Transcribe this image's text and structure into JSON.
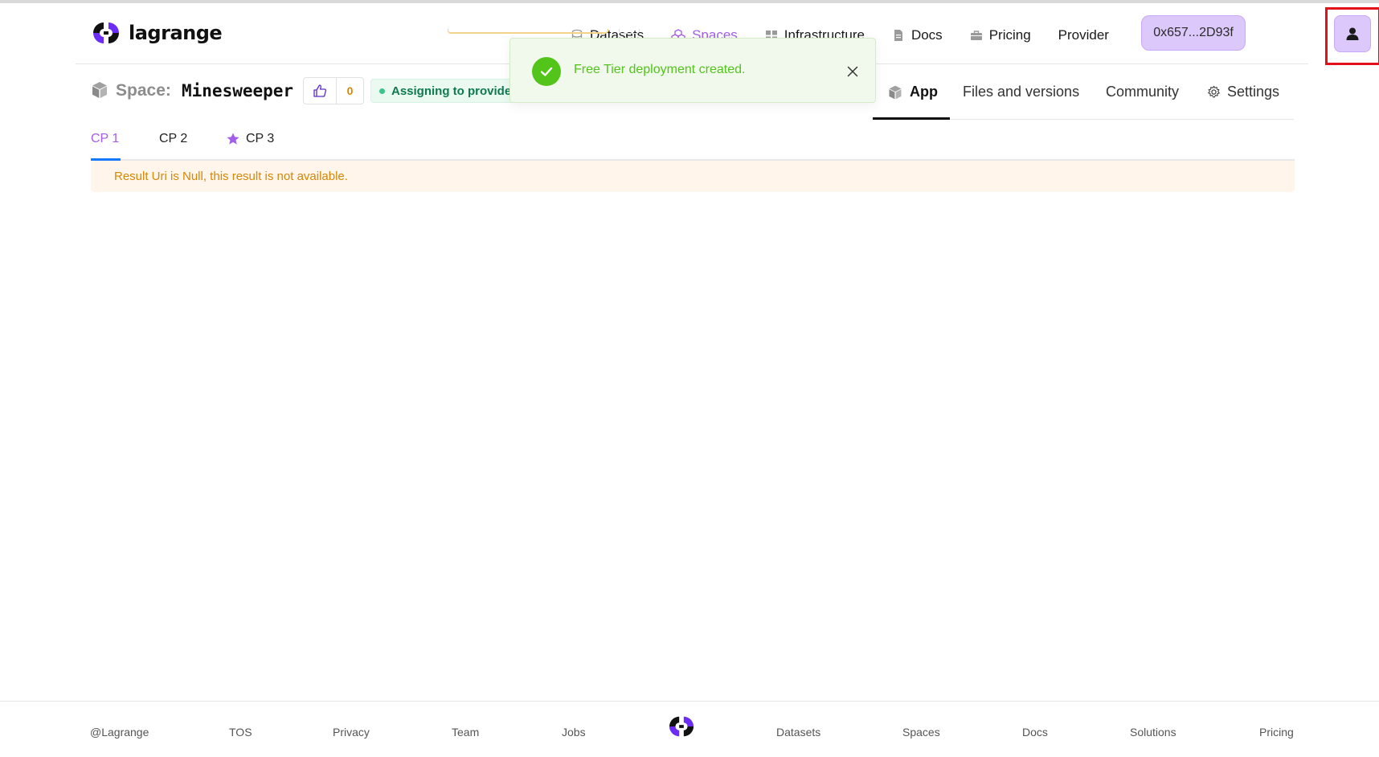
{
  "header": {
    "brand": "lagrange",
    "nav": [
      {
        "label": "Datasets",
        "icon": "database-icon"
      },
      {
        "label": "Spaces",
        "icon": "spaces-icon",
        "active": true
      },
      {
        "label": "Infrastructure",
        "icon": "grid-icon"
      },
      {
        "label": "Docs",
        "icon": "document-icon"
      },
      {
        "label": "Pricing",
        "icon": "briefcase-icon"
      },
      {
        "label": "Provider"
      }
    ],
    "wallet_label": "0x657...2D93f",
    "accent_color": "#a25ee8"
  },
  "space": {
    "label": "Space:",
    "name": "Minesweeper",
    "likes": "0",
    "status": "Assigning to provider"
  },
  "space_tabs": [
    {
      "label": "App",
      "active": true
    },
    {
      "label": "Files and versions"
    },
    {
      "label": "Community"
    },
    {
      "label": "Settings"
    }
  ],
  "toast": {
    "message": "Free Tier deployment created."
  },
  "cp_tabs": [
    {
      "label": "CP 1",
      "active": true
    },
    {
      "label": "CP 2"
    },
    {
      "label": "CP 3",
      "icon": "star-icon"
    }
  ],
  "alert": {
    "message": "Result Uri is Null, this result is not available."
  },
  "footer": {
    "items": [
      "@Lagrange",
      "TOS",
      "Privacy",
      "Team",
      "Jobs",
      "Datasets",
      "Spaces",
      "Docs",
      "Solutions",
      "Pricing"
    ]
  }
}
